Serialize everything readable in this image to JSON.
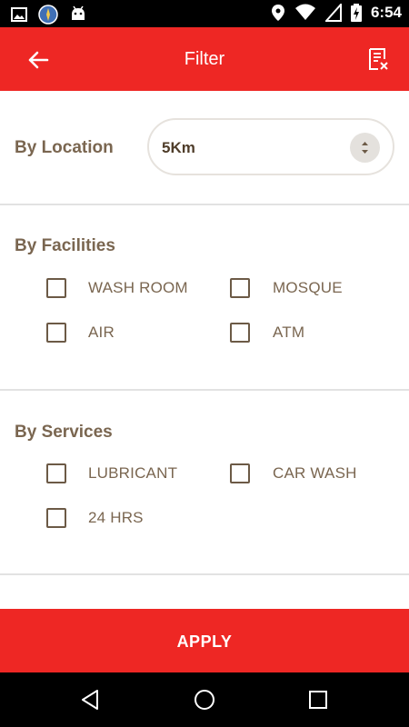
{
  "status_bar": {
    "time": "6:54",
    "icons": [
      "image-icon",
      "compass-icon",
      "android-icon",
      "location-icon",
      "wifi-icon",
      "signal-icon",
      "battery-charging-icon"
    ]
  },
  "app_bar": {
    "title": "Filter",
    "back_icon": "arrow-back-icon",
    "clear_icon": "clear-filter-icon",
    "background_color": "#ee2724"
  },
  "location": {
    "title": "By Location",
    "selected_value": "5Km"
  },
  "facilities": {
    "title": "By Facilities",
    "options": [
      {
        "label": "WASH ROOM",
        "checked": false
      },
      {
        "label": "MOSQUE",
        "checked": false
      },
      {
        "label": "AIR",
        "checked": false
      },
      {
        "label": "ATM",
        "checked": false
      }
    ]
  },
  "services": {
    "title": "By Services",
    "options": [
      {
        "label": "LUBRICANT",
        "checked": false
      },
      {
        "label": "CAR WASH",
        "checked": false
      },
      {
        "label": "24 HRS",
        "checked": false
      }
    ]
  },
  "apply_button": {
    "label": "APPLY"
  },
  "nav_bar": {
    "icons": [
      "back-triangle-icon",
      "home-circle-icon",
      "recents-square-icon"
    ]
  },
  "colors": {
    "accent": "#ee2724",
    "text_brown": "#7a6650",
    "divider": "#e2e2e2"
  }
}
